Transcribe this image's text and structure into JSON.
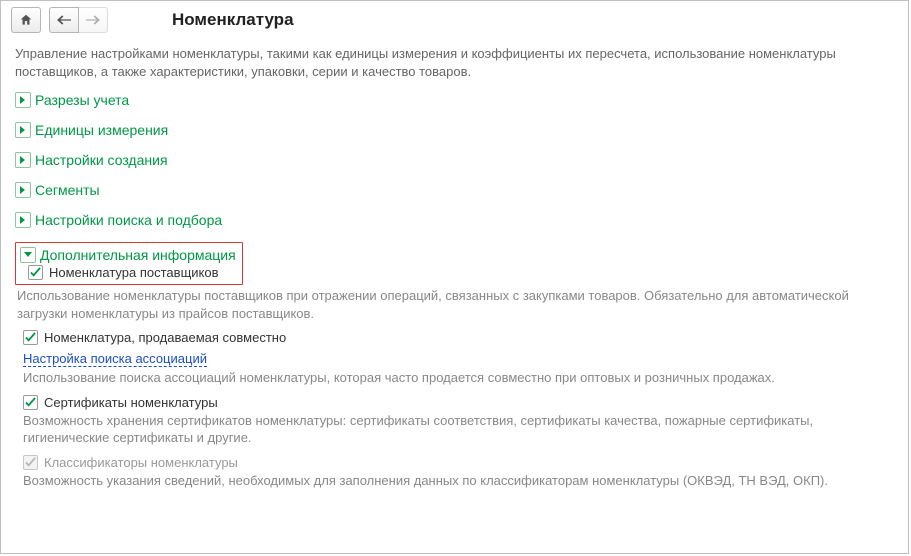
{
  "header": {
    "title": "Номенклатура"
  },
  "subtitle": "Управление настройками номенклатуры, такими как единицы измерения и коэффициенты их пересчета, использование номенклатуры поставщиков, а также характеристики, упаковки, серии и качество товаров.",
  "sections": {
    "s1": "Разрезы учета",
    "s2": "Единицы измерения",
    "s3": "Настройки создания",
    "s4": "Сегменты",
    "s5": "Настройки поиска и подбора",
    "s6": "Дополнительная информация"
  },
  "options": {
    "supplier_nomenclature": {
      "label": "Номенклатура поставщиков",
      "desc": "Использование номенклатуры поставщиков при отражении операций, связанных с закупками товаров. Обязательно для автоматической загрузки номенклатуры из прайсов поставщиков."
    },
    "sold_together": {
      "label": "Номенклатура, продаваемая совместно"
    },
    "assoc_link": "Настройка поиска ассоциаций",
    "assoc_desc": "Использование поиска ассоциаций номенклатуры, которая часто продается совместно при оптовых и розничных продажах.",
    "certificates": {
      "label": "Сертификаты номенклатуры",
      "desc": "Возможность хранения сертификатов номенклатуры: сертификаты соответствия, сертификаты качества, пожарные сертификаты, гигиенические сертификаты и другие."
    },
    "classifiers": {
      "label": "Классификаторы номенклатуры",
      "desc": "Возможность указания сведений, необходимых для заполнения данных по классификаторам номенклатуры (ОКВЭД, ТН ВЭД, ОКП)."
    }
  }
}
